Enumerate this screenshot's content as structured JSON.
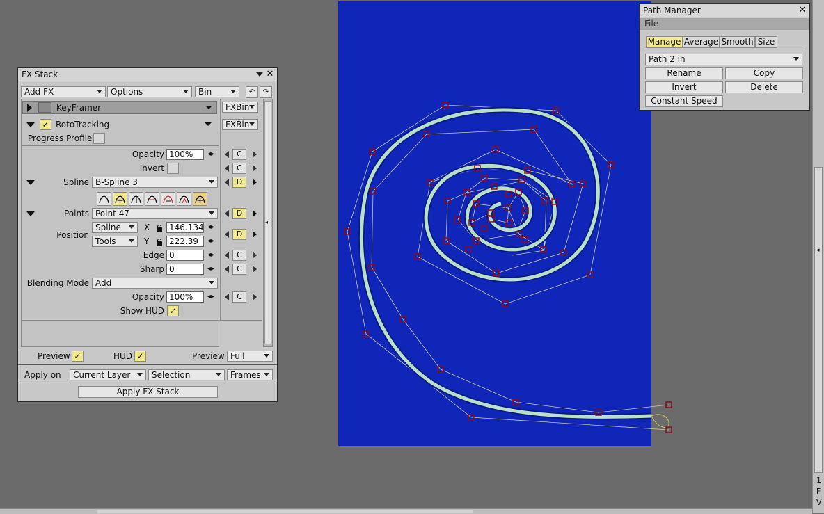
{
  "fx_stack": {
    "title": "FX Stack",
    "toolbar": {
      "add_fx": "Add FX",
      "options": "Options",
      "bin": "Bin"
    },
    "keyframer": {
      "label": "KeyFramer",
      "bin": "FXBin"
    },
    "rototracking": {
      "label": "RotoTracking",
      "bin": "FXBin",
      "progress_profile": "Progress Profile"
    },
    "params": {
      "opacity_label": "Opacity",
      "opacity_value": "100%",
      "invert_label": "Invert",
      "spline_label": "Spline",
      "spline_value": "B-Spline 3",
      "points_label": "Points",
      "points_value": "Point 47",
      "position_label": "Position",
      "pos_x_mode": "Spline",
      "pos_y_mode": "Tools",
      "x_label": "X",
      "x_value": "146.134",
      "y_label": "Y",
      "y_value": "222.39",
      "edge_label": "Edge",
      "edge_value": "0",
      "sharp_label": "Sharp",
      "sharp_value": "0",
      "blending_label": "Blending Mode",
      "blending_value": "Add",
      "opacity2_label": "Opacity",
      "opacity2_value": "100%",
      "show_hud_label": "Show HUD",
      "kf_c": "C",
      "kf_d": "D"
    },
    "footer": {
      "preview_label": "Preview",
      "hud_label": "HUD",
      "preview2_label": "Preview",
      "preview_value": "Full",
      "apply_on_label": "Apply on",
      "layer_value": "Current Layer",
      "selection_value": "Selection",
      "frames_value": "Frames",
      "apply_button": "Apply FX Stack"
    }
  },
  "path_manager": {
    "title": "Path Manager",
    "menu": "File",
    "tabs": [
      "Manage",
      "Average",
      "Smooth",
      "Size"
    ],
    "path_value": "Path 2 in",
    "buttons": {
      "rename": "Rename",
      "copy": "Copy",
      "invert": "Invert",
      "delete": "Delete",
      "constant_speed": "Constant Speed"
    }
  },
  "right_scroll": {
    "indicator_1": "1",
    "indicator_f": "F",
    "indicator_v": "V"
  },
  "colors": {
    "canvas": "#1026b8",
    "panel": "#c8c8c8",
    "highlight": "#f1ea8a",
    "spline": "#b8e0c8",
    "control_point": "#8b0a1e"
  }
}
